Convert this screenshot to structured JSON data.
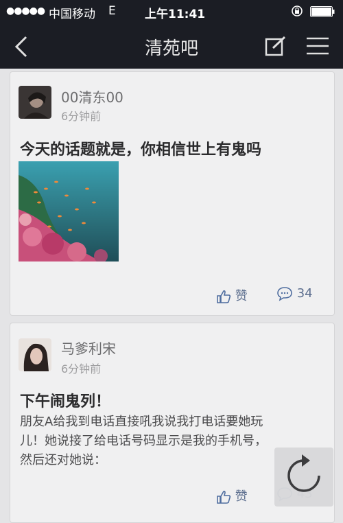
{
  "status_bar": {
    "signal": "●●●●●",
    "carrier": "中国移动",
    "network": "E",
    "time": "上午11:41"
  },
  "nav": {
    "title": "清苑吧",
    "back_icon": "chevron-left-icon",
    "compose_icon": "compose-icon",
    "menu_icon": "hamburger-menu-icon"
  },
  "posts": [
    {
      "username": "00清东00",
      "time_ago": "6分钟前",
      "title": "今天的话题就是，你相信世上有鬼吗",
      "body": "",
      "has_image": true,
      "like_label": "赞",
      "comment_count": "34"
    },
    {
      "username": "马爹利宋",
      "time_ago": "6分钟前",
      "title": "下午闹鬼列！",
      "body_lines": [
        "朋友A给我到电话直接吼我说我打电话要她玩",
        "儿！她说接了给电话号码显示是我的手机号，",
        "然后还对她说："
      ],
      "like_label": "赞",
      "comment_count": "43"
    }
  ],
  "colors": {
    "nav_background": "#1b1d24",
    "page_background": "#e4e4e6",
    "card_background": "#f0f0f1",
    "action_color": "#5d6f8f"
  },
  "icons": {
    "like": "thumbs-up-icon",
    "comment": "speech-bubble-icon",
    "refresh": "refresh-icon"
  }
}
